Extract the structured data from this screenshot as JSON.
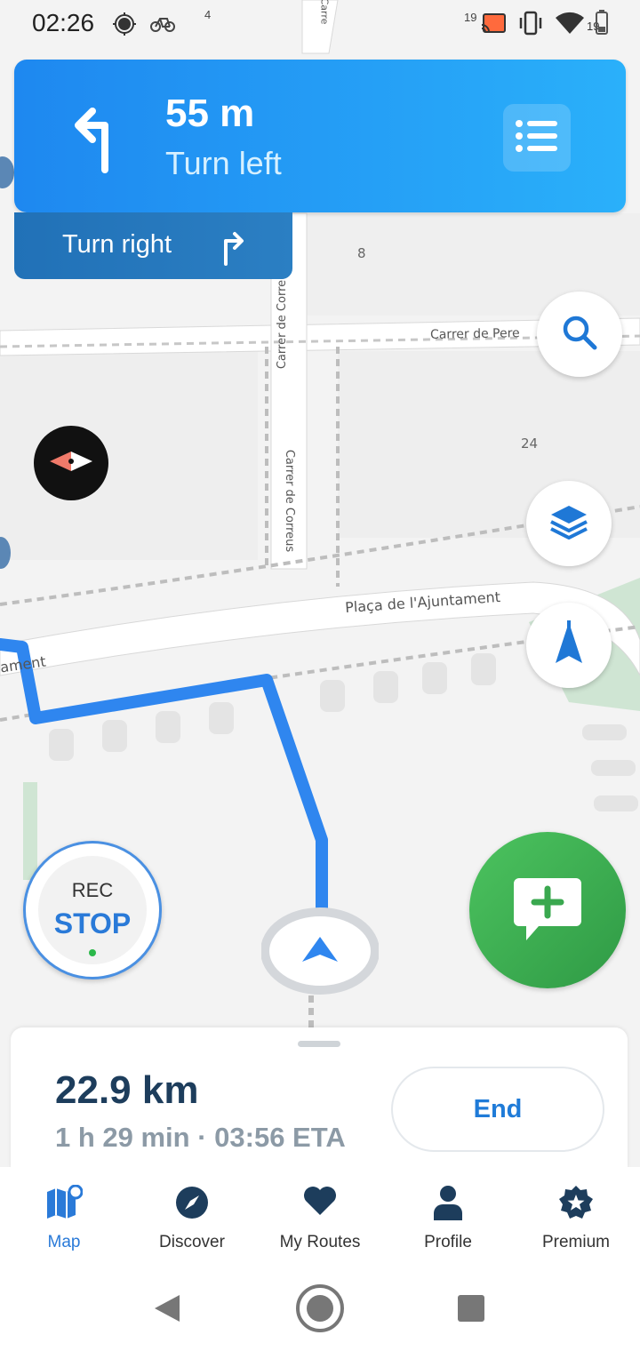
{
  "status_bar": {
    "time": "02:26",
    "small_number": "4",
    "left_icons": [
      "gps-icon",
      "bicycle-icon"
    ],
    "notif_count": "19",
    "battery_level": "19",
    "right_icons": [
      "cast-icon",
      "vibrate-icon",
      "wifi-icon",
      "battery-icon"
    ]
  },
  "navigation": {
    "distance": "55 m",
    "instruction": "Turn left",
    "turn_icon": "turn-left-arrow-icon",
    "list_icon": "list-icon",
    "next_instruction": "Turn right",
    "next_icon": "turn-right-arrow-icon"
  },
  "map": {
    "streets": [
      "Carrer de Pere",
      "Carrer de Correus",
      "Carrer de Correus",
      "Plaça de l'Ajuntament",
      "ament",
      "Carre"
    ],
    "building_numbers": [
      "8",
      "24"
    ],
    "route_color": "#2f86ef"
  },
  "controls": {
    "search_icon": "search-icon",
    "layers_icon": "layers-icon",
    "north_icon": "north-arrow-icon",
    "compass_icon": "compass-icon",
    "add_report_icon": "chat-plus-icon"
  },
  "recording": {
    "rec_label": "REC",
    "stop_label": "STOP"
  },
  "trip": {
    "distance": "22.9 km",
    "eta": "1 h 29 min · 03:56 ETA",
    "end_label": "End"
  },
  "tabs": [
    {
      "label": "Map",
      "icon": "map-icon",
      "active": true
    },
    {
      "label": "Discover",
      "icon": "compass-icon",
      "active": false
    },
    {
      "label": "My Routes",
      "icon": "heart-icon",
      "active": false
    },
    {
      "label": "Profile",
      "icon": "person-icon",
      "active": false
    },
    {
      "label": "Premium",
      "icon": "star-badge-icon",
      "active": false
    }
  ],
  "colors": {
    "accent": "#2a7ad8",
    "nav_gradient_start": "#1e88f0",
    "nav_gradient_end": "#2ab0fa",
    "report_green": "#3fb055"
  }
}
